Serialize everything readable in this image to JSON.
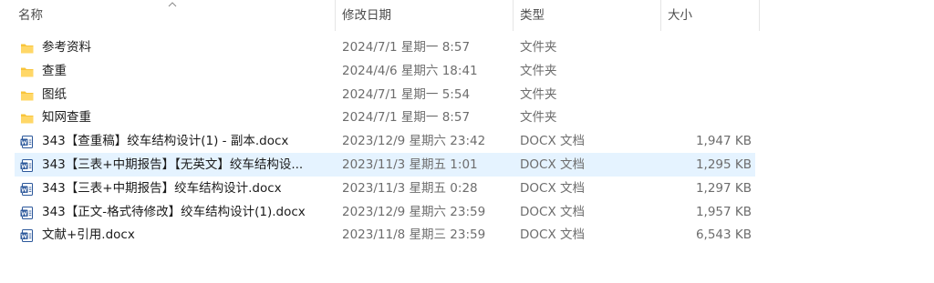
{
  "columns": {
    "name": "名称",
    "date": "修改日期",
    "type": "类型",
    "size": "大小"
  },
  "files": [
    {
      "name": "参考资料",
      "date": "2024/7/1 星期一 8:57",
      "type": "文件夹",
      "size": "",
      "icon": "folder-icon"
    },
    {
      "name": "查重",
      "date": "2024/4/6 星期六 18:41",
      "type": "文件夹",
      "size": "",
      "icon": "folder-icon"
    },
    {
      "name": "图纸",
      "date": "2024/7/1 星期一 5:54",
      "type": "文件夹",
      "size": "",
      "icon": "folder-icon"
    },
    {
      "name": "知网查重",
      "date": "2024/7/1 星期一 8:57",
      "type": "文件夹",
      "size": "",
      "icon": "folder-icon"
    },
    {
      "name": "343【查重稿】绞车结构设计(1) - 副本.docx",
      "date": "2023/12/9 星期六 23:42",
      "type": "DOCX 文档",
      "size": "1,947 KB",
      "icon": "word-doc-icon"
    },
    {
      "name": "343【三表+中期报告】【无英文】绞车结构设...",
      "date": "2023/11/3 星期五 1:01",
      "type": "DOCX 文档",
      "size": "1,295 KB",
      "icon": "word-doc-icon",
      "selected": true
    },
    {
      "name": "343【三表+中期报告】绞车结构设计.docx",
      "date": "2023/11/3 星期五 0:28",
      "type": "DOCX 文档",
      "size": "1,297 KB",
      "icon": "word-doc-icon"
    },
    {
      "name": "343【正文-格式待修改】绞车结构设计(1).docx",
      "date": "2023/12/9 星期六 23:59",
      "type": "DOCX 文档",
      "size": "1,957 KB",
      "icon": "word-doc-icon"
    },
    {
      "name": "文献+引用.docx",
      "date": "2023/11/8 星期三 23:59",
      "type": "DOCX 文档",
      "size": "6,543 KB",
      "icon": "word-doc-icon"
    }
  ],
  "colors": {
    "folder": "#f8c43a",
    "word": "#2b579a",
    "selected": "#e5f3ff"
  }
}
